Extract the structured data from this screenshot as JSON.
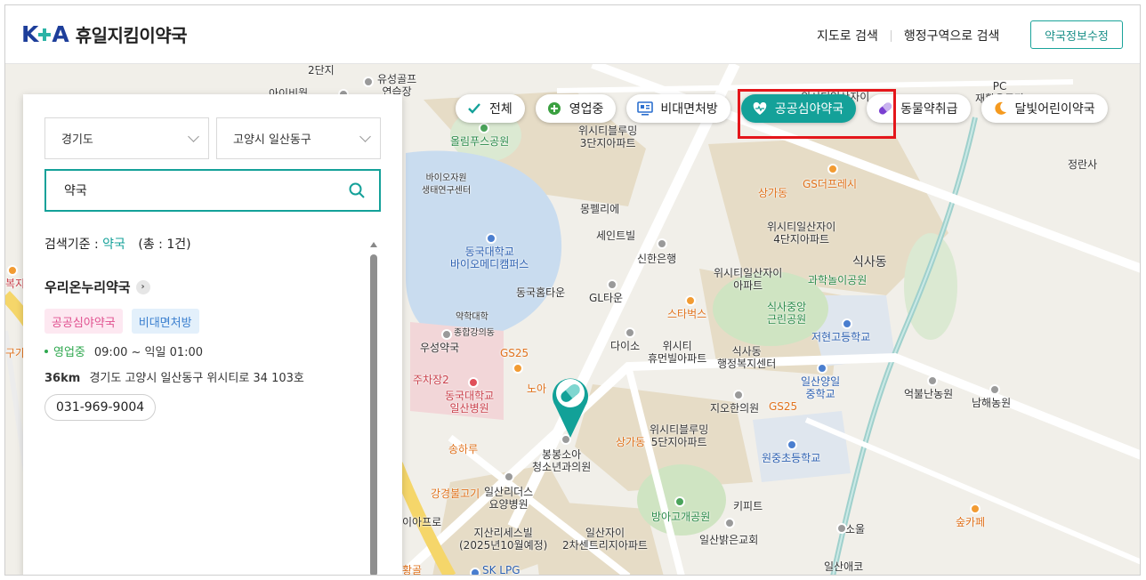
{
  "header": {
    "logo_mark": "KPA",
    "logo_text": "휴일지킴이약국",
    "nav": [
      "지도로 검색",
      "행정구역으로 검색"
    ],
    "edit_button": "약국정보수정"
  },
  "filters": [
    {
      "label": "전체",
      "icon": "check-icon",
      "active": false
    },
    {
      "label": "영업중",
      "icon": "plus-circle-icon",
      "active": false
    },
    {
      "label": "비대면처방",
      "icon": "monitor-icon",
      "active": false
    },
    {
      "label": "공공심야약국",
      "icon": "heart-icon",
      "active": true
    },
    {
      "label": "동물약취급",
      "icon": "pill-icon",
      "active": false
    },
    {
      "label": "달빛어린이약국",
      "icon": "moon-icon",
      "active": false
    }
  ],
  "panel": {
    "province": "경기도",
    "district": "고양시 일산동구",
    "search_value": "약국",
    "criteria_label": "검색기준 :",
    "criteria_keyword": "약국",
    "criteria_count": "(총 : 1건)",
    "result": {
      "name": "우리온누리약국",
      "tags": [
        "공공심야약국",
        "비대면처방"
      ],
      "status": "영업중",
      "hours": "09:00 ~ 익일 01:00",
      "distance": "36km",
      "address": "경기도 고양시 일산동구 위시티로 34 103호",
      "phone": "031-969-9004"
    }
  },
  "map_labels": {
    "l1": "유성골프\n연습장",
    "l2": "아이비월",
    "l3": "2단지",
    "l4": "올림푸스공원",
    "l5": "바이오자원\n생태연구센터",
    "l6": "위시티블루밍\n3단지아파트",
    "l7": "위시티일산자이",
    "l8": "PC\n재활용공장",
    "l9": "GS더프레시",
    "l10": "상가동",
    "l11": "위시티일산자이\n4단지아파트",
    "l12": "식사동",
    "l13": "과학놀이공원",
    "l14": "정란사",
    "l15": "몽펠리에",
    "l16": "세인트빌",
    "l17": "신한은행",
    "l18": "동국대학교\n바이오메디캠퍼스",
    "l19": "동국홈타운",
    "l20": "GL타운",
    "l21": "위시티일산자이\n아파트",
    "l22": "식사중앙\n근린공원",
    "l23": "약학대학",
    "l24": "종합강의동",
    "l25": "스타벅스",
    "l26": "저현고등학교",
    "l27": "우성약국",
    "l28": "다이소",
    "l29": "위시티\n휴먼빌아파트",
    "l30": "식사동\n행정복지센터",
    "l31": "GS25",
    "l32": "주차장2",
    "l33": "동국대학교\n일산병원",
    "l34": "노아",
    "l35": "일산양일\n중학교",
    "l36": "억불난농원",
    "l37": "남해농원",
    "l38": "지오한의원",
    "l39": "GS25",
    "l40": "상가동",
    "l41": "위시티블루밍\n5단지아파트",
    "l42": "송하루",
    "l43": "봉봉소아\n청소년과의원",
    "l44": "원중초등학교",
    "l45": "강경불고기",
    "l46": "일산리더스\n요양병원",
    "l47": "키피트",
    "l48": "방아고개공원",
    "l49": "숲카페",
    "l50": "이아프로",
    "l51": "지산리세스빌\n(2025년10월예정)",
    "l52": "일산자이\n2차센트리지아파트",
    "l53": "소울",
    "l54": "일산밝은교회",
    "l55": "SK LPG",
    "l56": "일산애코",
    "l57": "복지",
    "l58": "구가",
    "l59": "황골"
  }
}
